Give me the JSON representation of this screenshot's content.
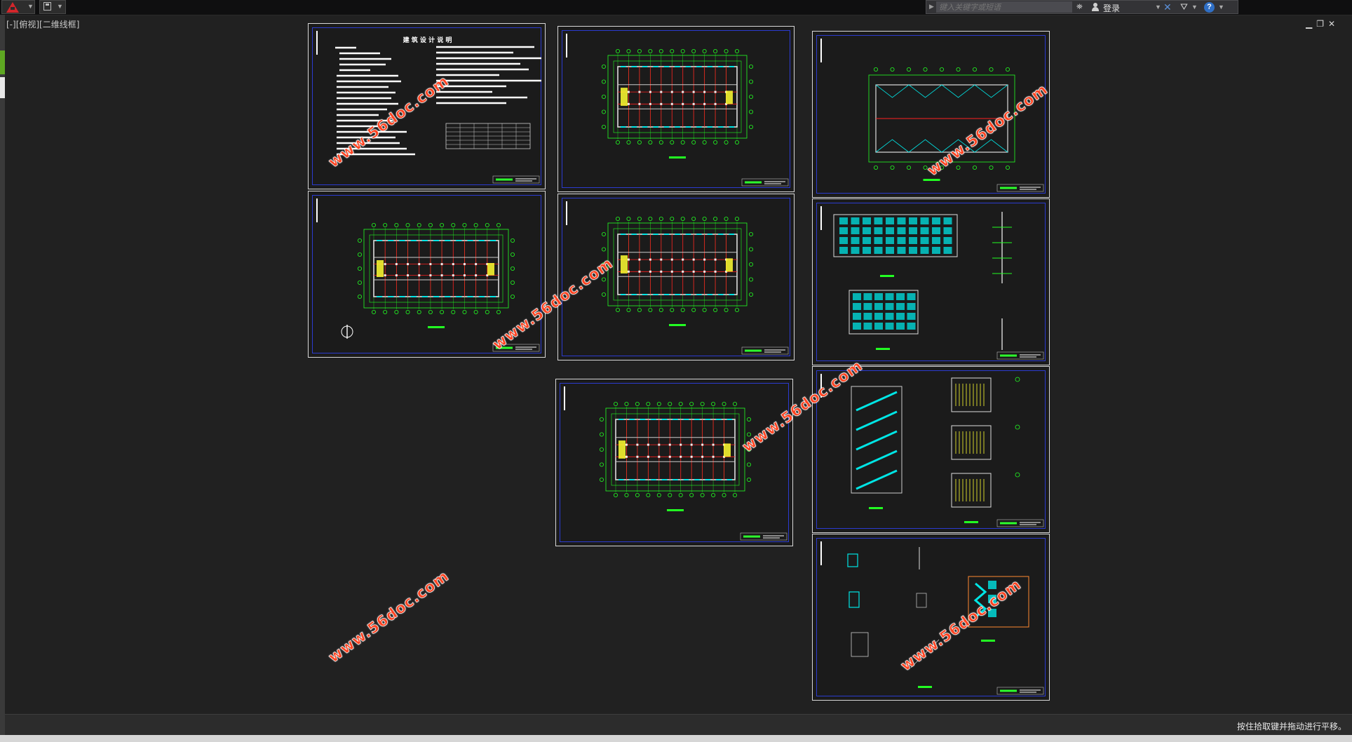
{
  "toolbar": {
    "search_placeholder": "键入关键字或短语",
    "login_label": "登录"
  },
  "viewport": {
    "label": "[-][俯视][二维线框]"
  },
  "status": {
    "message": "按住拾取键并拖动进行平移。"
  },
  "drawing": {
    "notes_title": "建 筑 设 计 说 明"
  },
  "watermark_text": "www.56doc.com",
  "colors": {
    "canvas": "#212121",
    "sheet_border": "#2b3bd0",
    "plan_green": "#22ff22",
    "plan_red": "#ff2020",
    "plan_cyan": "#00e5e5",
    "plan_yellow": "#ffff30",
    "watermark": "#ff4422"
  },
  "icons": [
    "autocad-logo-icon",
    "save-icon",
    "search-arrow-icon",
    "binoculars-icon",
    "user-icon",
    "exchange-x-icon",
    "a360-icon",
    "help-icon",
    "minimize-icon",
    "restore-icon",
    "close-icon"
  ]
}
